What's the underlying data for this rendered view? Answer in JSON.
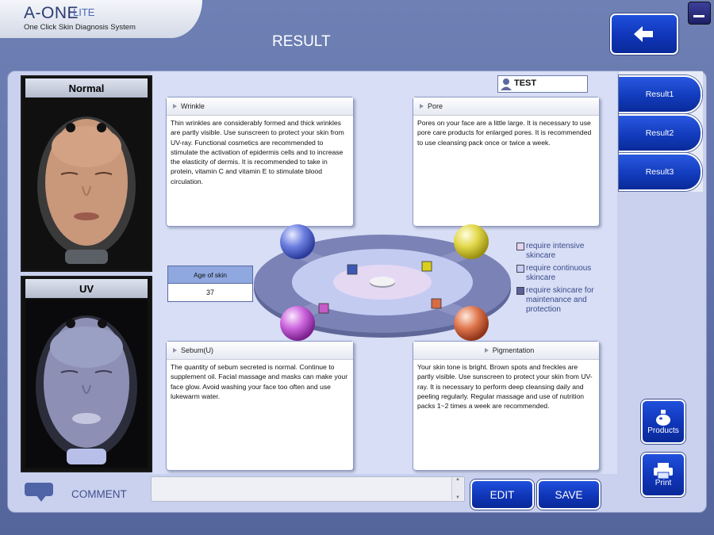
{
  "app": {
    "name": "A-ONE",
    "edition": "LITE",
    "subtitle": "One Click Skin Diagnosis System"
  },
  "page_title": "RESULT",
  "photos": {
    "normal_label": "Normal",
    "uv_label": "UV"
  },
  "user": {
    "name": "TEST"
  },
  "cards": {
    "wrinkle": {
      "title": "Wrinkle",
      "text": "Thin wrinkles are considerably formed and thick wrinkles are partly visible. Use sunscreen to protect your skin from UV-ray. Functional cosmetics are recommended to stimulate the activation of epidermis cells and to increase the elasticity of dermis. It is recommended to take in protein, vitamin C and vitamin E to stimulate blood circulation."
    },
    "pore": {
      "title": "Pore",
      "text": "Pores on your face are a little large. It is necessary to use pore care products for enlarged pores. It is recommended to use cleansing pack once or twice a week."
    },
    "sebum": {
      "title": "Sebum(U)",
      "text": "The quantity of sebum secreted is normal. Continue to supplement oil. Facial massage and masks can make your face glow. Avoid washing your face too often and use lukewarm water."
    },
    "pigmentation": {
      "title": "Pigmentation",
      "text": "Your skin tone is bright. Brown spots and freckles are partly visible. Use sunscreen to protect your skin from UV-ray. It is necessary to perform deep cleansing daily and peeling regularly. Regular massage and use of nutrition packs 1~2 times a week are recommended."
    }
  },
  "age_of_skin": {
    "label": "Age of skin",
    "value": "37"
  },
  "legend": [
    {
      "text": "require intensive skincare",
      "color": "#e3d4ee"
    },
    {
      "text": "require continuous skincare",
      "color": "#c5cdf2"
    },
    {
      "text": "require skincare for maintenance and protection",
      "color": "#5b6098"
    }
  ],
  "markers": {
    "wrinkle_color": "#3d59b6",
    "pore_color": "#d9cf1e",
    "sebum_color": "#c45bc6",
    "pigmentation_color": "#d46c46"
  },
  "tabs": [
    {
      "label": "Result1"
    },
    {
      "label": "Result2"
    },
    {
      "label": "Result3"
    }
  ],
  "buttons": {
    "products": "Products",
    "print": "Print",
    "edit": "EDIT",
    "save": "SAVE"
  },
  "icons": {
    "back": "arrow-left-icon",
    "minimize": "minimize-icon",
    "user": "user-icon",
    "comment": "speech-bubble-icon",
    "products": "bottle-icon",
    "print": "printer-icon"
  },
  "comment": {
    "label": "COMMENT",
    "value": ""
  }
}
